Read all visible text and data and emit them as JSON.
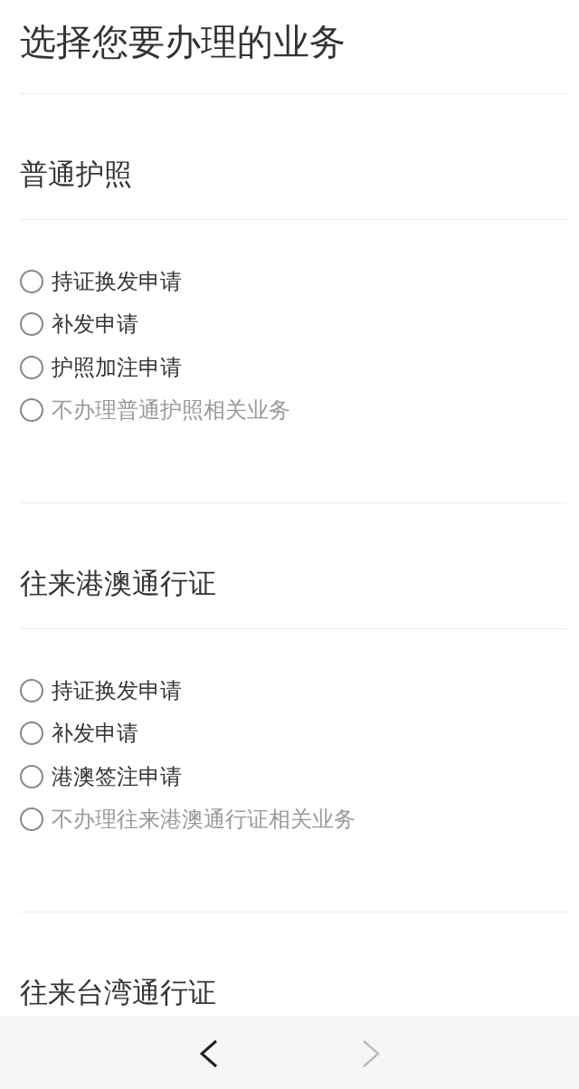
{
  "page_title": "选择您要办理的业务",
  "sections": [
    {
      "title": "普通护照",
      "options": [
        {
          "label": "持证换发申请",
          "kind": "service",
          "selected": false
        },
        {
          "label": "补发申请",
          "kind": "service",
          "selected": false
        },
        {
          "label": "护照加注申请",
          "kind": "service",
          "selected": false
        },
        {
          "label": "不办理普通护照相关业务",
          "kind": "decline",
          "selected": false
        }
      ]
    },
    {
      "title": "往来港澳通行证",
      "options": [
        {
          "label": "持证换发申请",
          "kind": "service",
          "selected": false
        },
        {
          "label": "补发申请",
          "kind": "service",
          "selected": false
        },
        {
          "label": "港澳签注申请",
          "kind": "service",
          "selected": false
        },
        {
          "label": "不办理往来港澳通行证相关业务",
          "kind": "decline",
          "selected": false
        }
      ]
    },
    {
      "title": "往来台湾通行证"
    }
  ],
  "bottom_bar": {
    "buttons": [
      {
        "kind": "back",
        "disabled": false
      },
      {
        "kind": "forward",
        "disabled": true
      }
    ]
  }
}
